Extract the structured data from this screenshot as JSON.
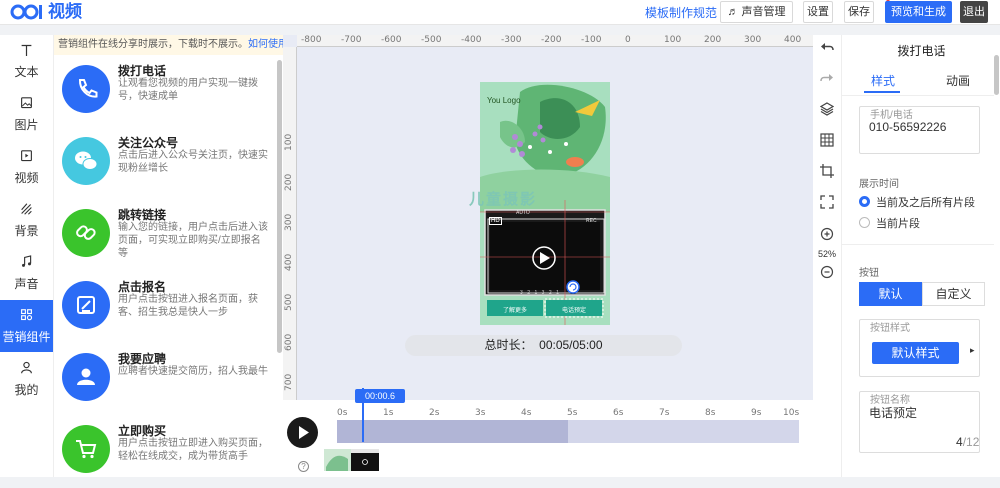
{
  "app": {
    "logo_text": "视频",
    "header_link": "模板制作规范",
    "sound_button": "声音管理",
    "settings_button": "设置",
    "save_button": "保存",
    "preview_button": "预览和生成",
    "exit_button": "退出"
  },
  "nav": [
    {
      "label": "文本",
      "icon": "text-icon"
    },
    {
      "label": "图片",
      "icon": "image-icon"
    },
    {
      "label": "视频",
      "icon": "video-icon"
    },
    {
      "label": "背景",
      "icon": "background-icon"
    },
    {
      "label": "声音",
      "icon": "music-icon"
    },
    {
      "label": "营销组件",
      "icon": "components-icon",
      "active": true
    },
    {
      "label": "我的",
      "icon": "user-icon"
    }
  ],
  "panel": {
    "notice": "营销组件在线分享时展示，下载时不展示。",
    "notice_link": "如何使用?",
    "items": [
      {
        "title": "拨打电话",
        "desc": "让观看您视频的用户实现一键拨号，快速成单",
        "color": "#2b6cf6",
        "icon": "phone-icon"
      },
      {
        "title": "关注公众号",
        "desc": "点击后进入公众号关注页，快速实现粉丝增长",
        "color": "#45c8e0",
        "icon": "wechat-icon"
      },
      {
        "title": "跳转链接",
        "desc": "输入您的链接，用户点击后进入该页面，可实现立即购买/立即报名等",
        "color": "#3ac42c",
        "icon": "link-icon"
      },
      {
        "title": "点击报名",
        "desc": "用户点击按钮进入报名页面，获客、招生我总是快人一步",
        "color": "#2b6cf6",
        "icon": "signup-icon"
      },
      {
        "title": "我要应聘",
        "desc": "应聘者快速提交简历，招人我最牛",
        "color": "#2b6cf6",
        "icon": "person-icon"
      },
      {
        "title": "立即购买",
        "desc": "用户点击按钮立即进入购买页面，轻松在线成交，成为带货高手",
        "color": "#3ac42c",
        "icon": "cart-icon"
      }
    ]
  },
  "canvas": {
    "ruler_top": [
      "-800",
      "-700",
      "-600",
      "-500",
      "-400",
      "-300",
      "-200",
      "-100",
      "0",
      "100",
      "200",
      "300",
      "400"
    ],
    "ruler_left": [
      "100",
      "200",
      "300",
      "400",
      "500",
      "600",
      "700"
    ],
    "phone_logo": "You Logo",
    "watermark": "儿童摄影",
    "cam_auto": "AUTO",
    "cam_rec": "REC",
    "cam_hd": "HD",
    "cam_counter": "3 - 2 - 1 - 3 - 2 - 1",
    "btn_left": "了解更多",
    "btn_right": "电话预定",
    "duration_label": "总时长：",
    "duration_value": "00:05/05:00"
  },
  "props": {
    "title": "拨打电话",
    "tab_style": "样式",
    "tab_anim": "动画",
    "phone_caption": "手机/电话",
    "phone_value": "010-56592226",
    "time_label": "展示时间",
    "radio_all": "当前及之后所有片段",
    "radio_current": "当前片段",
    "button_label": "按钮",
    "seg_default": "默认",
    "seg_custom": "自定义",
    "style_caption": "按钮样式",
    "style_btn": "默认样式",
    "name_caption": "按钮名称",
    "name_value": "电话预定",
    "char_count": "4",
    "char_total": "/12"
  },
  "timeline": {
    "playhead_label": "00:00.6",
    "ticks": [
      "0s",
      "1s",
      "2s",
      "3s",
      "4s",
      "5s",
      "6s",
      "7s",
      "8s",
      "9s",
      "10s"
    ],
    "zoom": "52%"
  }
}
